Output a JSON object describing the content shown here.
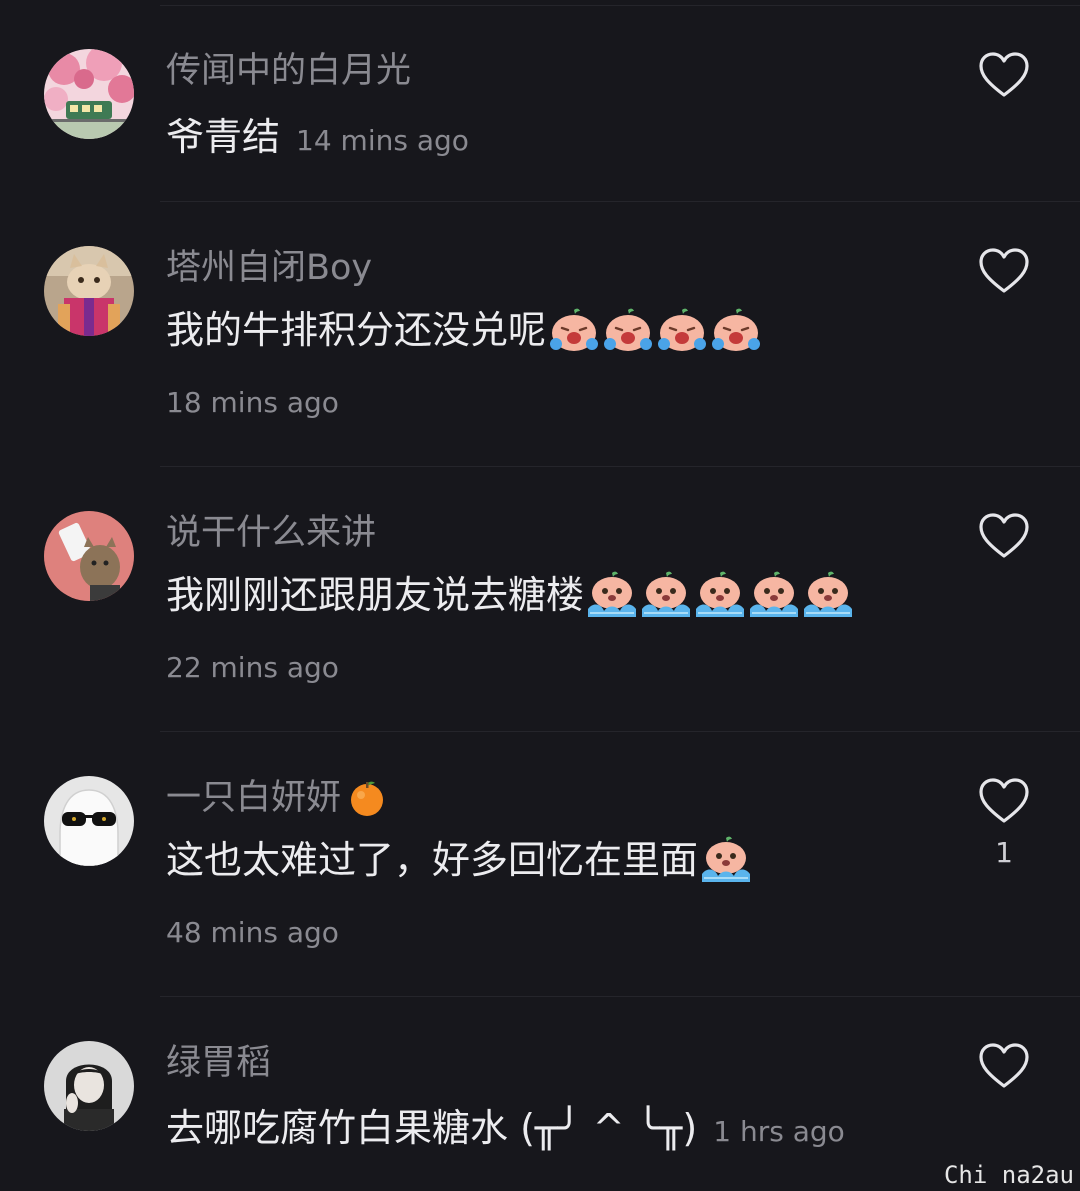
{
  "comments": [
    {
      "username": "传闻中的白月光",
      "text": "爷青结",
      "time": "14 mins ago",
      "avatar": "avatar-cherry-blossom-train",
      "like_count": ""
    },
    {
      "username": "塔州自闭Boy",
      "text": "我的牛排积分还没兑呢",
      "emoji": "crying-face-emoji",
      "emoji_count": 4,
      "time": "18 mins ago",
      "avatar": "avatar-cat-costume",
      "like_count": ""
    },
    {
      "username": "说干什么来讲",
      "text": "我刚刚还跟朋友说去糖楼",
      "emoji": "sobbing-face-emoji",
      "emoji_count": 5,
      "time": "22 mins ago",
      "avatar": "avatar-cat-phone",
      "like_count": ""
    },
    {
      "username": "一只白妍妍",
      "username_emoji": "tangerine-emoji",
      "text": "这也太难过了，好多回忆在里面",
      "emoji": "sobbing-face-emoji",
      "emoji_count": 1,
      "time": "48 mins ago",
      "avatar": "avatar-ghost-sunglasses",
      "like_count": "1"
    },
    {
      "username": "绿胃稻",
      "text": "去哪吃腐竹白果糖水 (╥╯ ^ ╰╥)",
      "time": "1 hrs ago",
      "avatar": "avatar-portrait-bw",
      "like_count": ""
    }
  ],
  "watermark": "Chi na2au",
  "colors": {
    "background": "#17171c",
    "divider": "#25252b",
    "username": "#8a8a91",
    "text": "#ececef",
    "timestamp": "#8a8a91",
    "like_icon": "#e6e6ea"
  }
}
